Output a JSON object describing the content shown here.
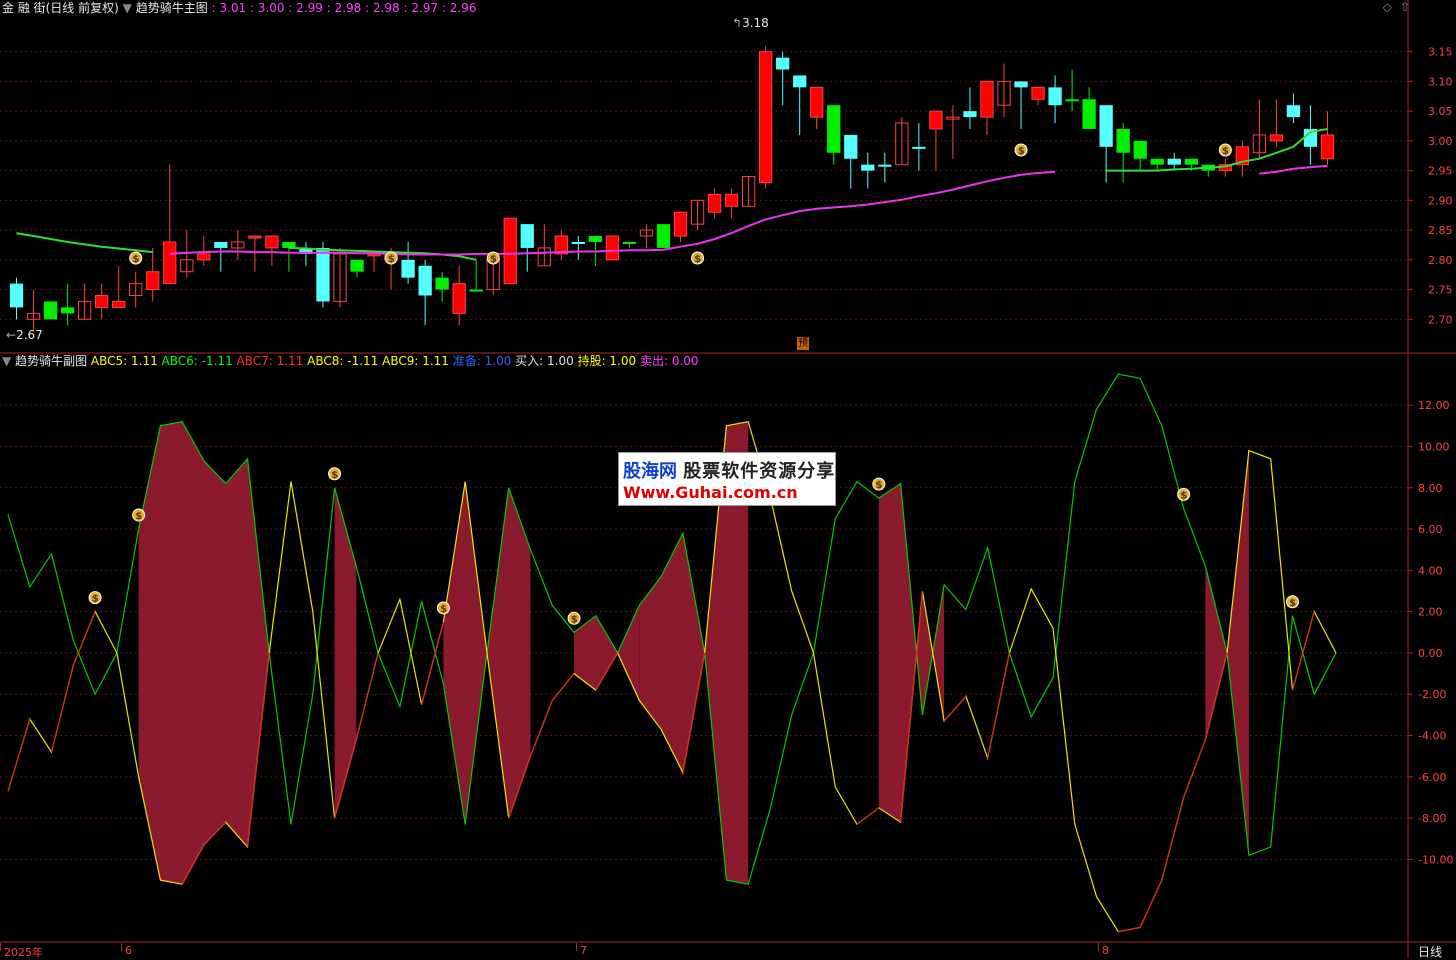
{
  "app": {
    "title": "金 融 街(日线 前复权)",
    "period_label": "日线"
  },
  "main_indicator": {
    "name": "趋势骑牛主图",
    "values_text": ": 3.01 : 3.00 : 2.99 : 2.98 : 2.98 : 2.97 : 2.96"
  },
  "sub_indicator": {
    "name": "趋势骑牛副图",
    "items": [
      {
        "label": "ABC5: 1.11",
        "color": "#ffff00"
      },
      {
        "label": "ABC6: -1.11",
        "color": "#00ff00"
      },
      {
        "label": "ABC7: 1.11",
        "color": "#ff3030"
      },
      {
        "label": "ABC8: -1.11",
        "color": "#ffff00"
      },
      {
        "label": "ABC9: 1.11",
        "color": "#ffff00"
      },
      {
        "label": "准备: 1.00",
        "color": "#3060ff"
      },
      {
        "label": "买入: 1.00",
        "color": "#e0e0e0"
      },
      {
        "label": "持股: 1.00",
        "color": "#ffff00"
      },
      {
        "label": "卖出: 0.00",
        "color": "#ff40ff"
      }
    ]
  },
  "annotations": {
    "high": "3.18",
    "low": "2.67",
    "marker": "预"
  },
  "x_axis": [
    {
      "label": "2025年",
      "x": 0
    },
    {
      "label": "6",
      "x": 121
    },
    {
      "label": "7",
      "x": 576
    },
    {
      "label": "8",
      "x": 1098
    }
  ],
  "watermark": {
    "line1a": "股海网",
    "line1b": "股票软件资源分享",
    "line2": "Www.Guhai.com.cn"
  },
  "colors": {
    "up": "#ff0000",
    "down_solid": "#00ee00",
    "down_hollow": "#55ffff",
    "ma_green": "#33dd33",
    "ma_magenta": "#ee33ee",
    "fill": "#8b1a2e",
    "grid": "#5a1010",
    "axis": "#b22222"
  },
  "chart_data": [
    {
      "type": "candlestick",
      "title": "趋势骑牛主图",
      "y_ticks": [
        2.7,
        2.75,
        2.8,
        2.85,
        2.9,
        2.95,
        3.0,
        3.05,
        3.1,
        3.15
      ],
      "ylim": [
        2.645,
        3.21
      ],
      "candles": [
        [
          2.76,
          2.77,
          2.7,
          2.72,
          "d"
        ],
        [
          2.7,
          2.75,
          2.68,
          2.71,
          "r"
        ],
        [
          2.73,
          2.73,
          2.7,
          2.7,
          "g"
        ],
        [
          2.72,
          2.76,
          2.69,
          2.71,
          "g"
        ],
        [
          2.7,
          2.76,
          2.7,
          2.73,
          "r"
        ],
        [
          2.72,
          2.76,
          2.7,
          2.74,
          "r"
        ],
        [
          2.73,
          2.79,
          2.72,
          2.72,
          "r"
        ],
        [
          2.74,
          2.78,
          2.72,
          2.76,
          "r"
        ],
        [
          2.75,
          2.82,
          2.73,
          2.78,
          "r"
        ],
        [
          2.76,
          2.96,
          2.76,
          2.83,
          "r"
        ],
        [
          2.78,
          2.85,
          2.77,
          2.8,
          "r"
        ],
        [
          2.8,
          2.84,
          2.79,
          2.81,
          "r"
        ],
        [
          2.82,
          2.83,
          2.78,
          2.83,
          "d"
        ],
        [
          2.82,
          2.85,
          2.8,
          2.83,
          "r"
        ],
        [
          2.84,
          2.84,
          2.78,
          2.84,
          "r"
        ],
        [
          2.84,
          2.84,
          2.79,
          2.82,
          "r"
        ],
        [
          2.83,
          2.83,
          2.78,
          2.82,
          "g"
        ],
        [
          2.82,
          2.83,
          2.79,
          2.81,
          "d"
        ],
        [
          2.82,
          2.83,
          2.72,
          2.73,
          "d"
        ],
        [
          2.81,
          2.82,
          2.72,
          2.73,
          "r"
        ],
        [
          2.8,
          2.8,
          2.77,
          2.78,
          "g"
        ],
        [
          2.81,
          2.81,
          2.78,
          2.81,
          "r"
        ],
        [
          2.81,
          2.82,
          2.75,
          2.8,
          "r"
        ],
        [
          2.8,
          2.83,
          2.76,
          2.77,
          "d"
        ],
        [
          2.79,
          2.8,
          2.69,
          2.74,
          "d"
        ],
        [
          2.77,
          2.78,
          2.73,
          2.75,
          "g"
        ],
        [
          2.76,
          2.79,
          2.69,
          2.71,
          "r"
        ],
        [
          2.75,
          2.8,
          2.75,
          2.75,
          "g"
        ],
        [
          2.75,
          2.8,
          2.74,
          2.8,
          "r"
        ],
        [
          2.76,
          2.87,
          2.76,
          2.87,
          "r"
        ],
        [
          2.82,
          2.86,
          2.78,
          2.86,
          "d"
        ],
        [
          2.79,
          2.86,
          2.79,
          2.82,
          "r"
        ],
        [
          2.81,
          2.85,
          2.8,
          2.84,
          "r"
        ],
        [
          2.83,
          2.84,
          2.8,
          2.83,
          "d"
        ],
        [
          2.84,
          2.84,
          2.79,
          2.83,
          "g"
        ],
        [
          2.8,
          2.84,
          2.8,
          2.84,
          "r"
        ],
        [
          2.83,
          2.83,
          2.82,
          2.83,
          "g"
        ],
        [
          2.84,
          2.86,
          2.82,
          2.85,
          "r"
        ],
        [
          2.86,
          2.86,
          2.82,
          2.82,
          "g"
        ],
        [
          2.84,
          2.88,
          2.83,
          2.88,
          "r"
        ],
        [
          2.86,
          2.9,
          2.85,
          2.9,
          "r"
        ],
        [
          2.88,
          2.92,
          2.87,
          2.91,
          "r"
        ],
        [
          2.89,
          2.92,
          2.87,
          2.91,
          "r"
        ],
        [
          2.89,
          2.94,
          2.89,
          2.94,
          "r"
        ],
        [
          2.93,
          3.16,
          2.92,
          3.15,
          "r"
        ],
        [
          3.14,
          3.15,
          3.06,
          3.12,
          "d"
        ],
        [
          3.11,
          3.11,
          3.01,
          3.09,
          "d"
        ],
        [
          3.09,
          3.09,
          3.02,
          3.04,
          "r"
        ],
        [
          3.06,
          3.06,
          2.96,
          2.98,
          "g"
        ],
        [
          3.01,
          3.01,
          2.92,
          2.97,
          "d"
        ],
        [
          2.96,
          2.98,
          2.92,
          2.95,
          "d"
        ],
        [
          2.96,
          2.98,
          2.93,
          2.96,
          "d"
        ],
        [
          2.96,
          3.04,
          2.96,
          3.03,
          "r"
        ],
        [
          2.99,
          3.03,
          2.95,
          2.99,
          "d"
        ],
        [
          3.02,
          3.05,
          2.95,
          3.05,
          "r"
        ],
        [
          3.04,
          3.06,
          2.97,
          3.04,
          "r"
        ],
        [
          3.05,
          3.09,
          3.02,
          3.04,
          "d"
        ],
        [
          3.04,
          3.1,
          3.01,
          3.1,
          "r"
        ],
        [
          3.06,
          3.13,
          3.04,
          3.1,
          "r"
        ],
        [
          3.1,
          3.1,
          3.02,
          3.09,
          "d"
        ],
        [
          3.09,
          3.09,
          3.06,
          3.07,
          "r"
        ],
        [
          3.09,
          3.11,
          3.03,
          3.06,
          "d"
        ],
        [
          3.07,
          3.12,
          3.05,
          3.07,
          "g"
        ],
        [
          3.07,
          3.09,
          3.02,
          3.02,
          "g"
        ],
        [
          3.06,
          3.06,
          2.93,
          2.99,
          "d"
        ],
        [
          3.02,
          3.03,
          2.93,
          2.98,
          "g"
        ],
        [
          3.0,
          3.0,
          2.95,
          2.97,
          "g"
        ],
        [
          2.97,
          2.97,
          2.95,
          2.96,
          "g"
        ],
        [
          2.97,
          2.98,
          2.95,
          2.96,
          "d"
        ],
        [
          2.97,
          2.97,
          2.95,
          2.96,
          "g"
        ],
        [
          2.95,
          2.96,
          2.94,
          2.96,
          "g"
        ],
        [
          2.95,
          2.97,
          2.94,
          2.96,
          "r"
        ],
        [
          2.96,
          3.0,
          2.94,
          2.99,
          "r"
        ],
        [
          2.98,
          3.07,
          2.97,
          3.01,
          "r"
        ],
        [
          3.01,
          3.07,
          2.99,
          3.0,
          "r"
        ],
        [
          3.06,
          3.08,
          3.03,
          3.04,
          "d"
        ],
        [
          3.02,
          3.06,
          2.96,
          2.99,
          "d"
        ],
        [
          2.97,
          3.05,
          2.96,
          3.01,
          "r"
        ]
      ],
      "series": [
        {
          "type": "line",
          "color": "#33dd33",
          "values": [
            2.845,
            2.84,
            2.835,
            2.83,
            2.826,
            2.822,
            2.819,
            2.816,
            2.813,
            null,
            null,
            null,
            null,
            null,
            null,
            null,
            2.82,
            2.819,
            2.817,
            2.816,
            2.815,
            2.814,
            2.813,
            2.812,
            2.811,
            2.809,
            2.806,
            2.8
          ]
        },
        {
          "type": "line",
          "color": "#ee33ee",
          "values": [
            null,
            null,
            null,
            null,
            null,
            null,
            null,
            null,
            null,
            2.81,
            2.812,
            2.813,
            2.814,
            2.814,
            2.813,
            2.813,
            2.812,
            2.812,
            2.812,
            2.812,
            2.811,
            2.811,
            2.81,
            2.809,
            2.809,
            2.809,
            2.809,
            2.81,
            2.81,
            2.81,
            2.811,
            2.812,
            2.813,
            2.814,
            2.814,
            2.815,
            2.816,
            2.816,
            2.817,
            2.822,
            2.827,
            2.835,
            2.845,
            2.857,
            2.868,
            2.875,
            2.882,
            2.886,
            2.888,
            2.89,
            2.893,
            2.897,
            2.901,
            2.907,
            2.912,
            2.918,
            2.925,
            2.932,
            2.938,
            2.943,
            2.946,
            2.948,
            null,
            null,
            null,
            null,
            null,
            null,
            null,
            null,
            null,
            null,
            null,
            2.945,
            2.948,
            2.953,
            2.956,
            2.958
          ]
        },
        {
          "type": "line",
          "color": "#33dd33",
          "values": [
            null,
            null,
            null,
            null,
            null,
            null,
            null,
            null,
            null,
            null,
            null,
            null,
            null,
            null,
            null,
            null,
            null,
            null,
            null,
            null,
            null,
            null,
            null,
            null,
            null,
            null,
            null,
            null,
            null,
            null,
            null,
            null,
            null,
            null,
            null,
            null,
            null,
            null,
            null,
            null,
            null,
            null,
            null,
            null,
            null,
            null,
            null,
            null,
            null,
            null,
            null,
            null,
            null,
            null,
            null,
            null,
            null,
            null,
            null,
            null,
            null,
            null,
            null,
            null,
            2.95,
            2.95,
            2.95,
            2.95,
            2.952,
            2.953,
            2.955,
            2.957,
            2.965,
            2.97,
            2.98,
            2.99,
            3.015,
            3.02
          ]
        }
      ],
      "buy_marker_candles": [
        7,
        22,
        28,
        40,
        59,
        71
      ],
      "annotations": {
        "high": "3.18",
        "low": "2.67"
      }
    },
    {
      "type": "area",
      "title": "趋势骑牛副图",
      "y_ticks": [
        -10,
        -8,
        -6,
        -4,
        -2,
        0,
        2,
        4,
        6,
        8,
        10,
        12
      ],
      "ylim": [
        -14,
        13.8
      ],
      "series": [
        {
          "name": "ABC5",
          "color": "#ffff00",
          "values": [
            -6.7,
            -3.2,
            -4.8,
            -0.6,
            2.0,
            0.0,
            -6.0,
            -11.0,
            -11.2,
            -9.3,
            -8.2,
            -9.4,
            0.0,
            8.3,
            2.0,
            -8.0,
            -4.2,
            0.0,
            2.6,
            -2.5,
            1.5,
            8.3,
            0.0,
            -8.0,
            -5.0,
            -2.3,
            -1.0,
            -1.8,
            0.0,
            -2.3,
            -3.7,
            -5.8,
            0.0,
            11.0,
            11.2,
            7.6,
            3.0,
            0.0,
            -6.5,
            -8.3,
            -7.5,
            -8.2,
            3.0,
            -3.3,
            -2.1,
            -5.1,
            0.0,
            3.1,
            1.2,
            -8.3,
            -11.8,
            -13.5,
            -13.3,
            -11.0,
            -7.0,
            -4.2,
            0.0,
            9.8,
            9.4,
            -1.8,
            2.0,
            0.0
          ]
        },
        {
          "name": "ABC6",
          "color": "#00ff00",
          "values": [
            6.7,
            3.2,
            4.8,
            0.6,
            -2.0,
            0.0,
            6.0,
            11.0,
            11.2,
            9.3,
            8.2,
            9.4,
            0.0,
            -8.3,
            -2.0,
            8.0,
            4.2,
            0.0,
            -2.6,
            2.5,
            -1.5,
            -8.3,
            0.0,
            8.0,
            5.0,
            2.3,
            1.0,
            1.8,
            0.0,
            2.3,
            3.7,
            5.8,
            0.0,
            -11.0,
            -11.2,
            -7.6,
            -3.0,
            0.0,
            6.5,
            8.3,
            7.5,
            8.2,
            -3.0,
            3.3,
            2.1,
            5.1,
            0.0,
            -3.1,
            -1.2,
            8.3,
            11.8,
            13.5,
            13.3,
            11.0,
            7.0,
            4.2,
            0.0,
            -9.8,
            -9.4,
            1.8,
            -2.0,
            0.0
          ]
        },
        {
          "name": "ABC7",
          "color": "#ff3030",
          "values": [
            -6.7,
            -3.2,
            -4.8,
            -0.6,
            2.0,
            0.0,
            -6.0,
            -11.0,
            -11.2,
            -9.3,
            -8.2,
            -9.4,
            0.0,
            8.3,
            2.0,
            -8.0,
            -4.2,
            0.0,
            2.6,
            -2.5,
            1.5,
            8.3,
            0.0,
            -8.0,
            -5.0,
            -2.3,
            -1.0,
            -1.8,
            0.0,
            -2.3,
            -3.7,
            -5.8,
            0.0,
            11.0,
            11.2,
            7.6,
            3.0,
            0.0,
            -6.5,
            -8.3,
            -7.5,
            -8.2,
            3.0,
            -3.3,
            -2.1,
            -5.1,
            0.0,
            3.1,
            1.2,
            -8.3,
            -11.8,
            -13.5,
            -13.3,
            -11.0,
            -7.0,
            -4.2,
            0.0,
            9.8,
            9.4,
            -1.8,
            2.0,
            0.0
          ]
        }
      ],
      "fill_ranges": [
        [
          6,
          12
        ],
        [
          15,
          16
        ],
        [
          20,
          24
        ],
        [
          26,
          29
        ],
        [
          29,
          34
        ],
        [
          40,
          43
        ],
        [
          55,
          57
        ]
      ],
      "buy_marker_points": [
        4,
        6,
        15,
        20,
        26,
        40,
        54,
        59
      ]
    }
  ]
}
